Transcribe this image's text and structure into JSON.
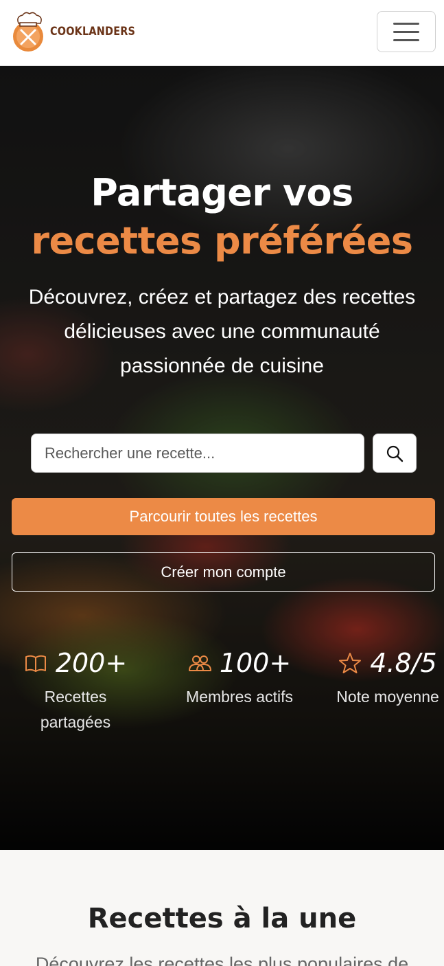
{
  "brand": {
    "name": "COOKLANDERS"
  },
  "nav": {
    "toggle_icon": "hamburger-menu-icon"
  },
  "hero": {
    "title_part1": "Partager vos ",
    "title_accent": "recettes préférées",
    "subtitle": "Découvrez, créez et partagez des recettes délicieuses avec une communauté passionnée de cuisine",
    "search_placeholder": "Rechercher une recette...",
    "primary_button": "Parcourir toutes les recettes",
    "secondary_button": "Créer mon compte",
    "accent_color": "#ec8a46"
  },
  "stats": [
    {
      "icon": "book-icon",
      "value": "200+",
      "label": "Recettes partagées"
    },
    {
      "icon": "users-icon",
      "value": "100+",
      "label": "Membres actifs"
    },
    {
      "icon": "star-icon",
      "value": "4.8/5",
      "label": "Note moyenne"
    }
  ],
  "featured": {
    "title": "Recettes à la une",
    "subtitle": "Découvrez les recettes les plus populaires de"
  }
}
